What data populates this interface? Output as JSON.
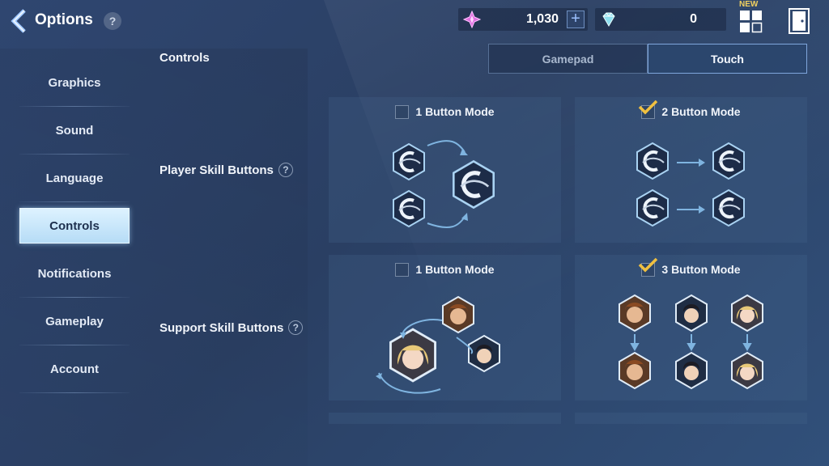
{
  "header": {
    "title": "Options",
    "help": "?"
  },
  "currency": {
    "gems": "1,030",
    "gems_plus": "+",
    "diamonds": "0"
  },
  "new_badge": "NEW",
  "sidebar": {
    "items": [
      {
        "label": "Graphics"
      },
      {
        "label": "Sound"
      },
      {
        "label": "Language"
      },
      {
        "label": "Controls",
        "active": true
      },
      {
        "label": "Notifications"
      },
      {
        "label": "Gameplay"
      },
      {
        "label": "Account"
      }
    ]
  },
  "main": {
    "section_label": "Controls",
    "tabs": [
      {
        "label": "Gamepad"
      },
      {
        "label": "Touch",
        "selected": true
      }
    ],
    "rows": [
      {
        "label": "Player Skill Buttons",
        "help": "?",
        "options": [
          {
            "label": "1 Button Mode",
            "checked": false
          },
          {
            "label": "2 Button Mode",
            "checked": true
          }
        ]
      },
      {
        "label": "Support Skill Buttons",
        "help": "?",
        "options": [
          {
            "label": "1 Button Mode",
            "checked": false
          },
          {
            "label": "3 Button Mode",
            "checked": true
          }
        ]
      }
    ]
  },
  "colors": {
    "accent": "#f0c040",
    "active_tab": "#b6dcf6",
    "bg": "#2f4670"
  },
  "icons": [
    "chevron-left-icon",
    "help-icon",
    "pink-gem-icon",
    "diamond-icon",
    "menu-grid-icon",
    "exit-door-icon"
  ]
}
